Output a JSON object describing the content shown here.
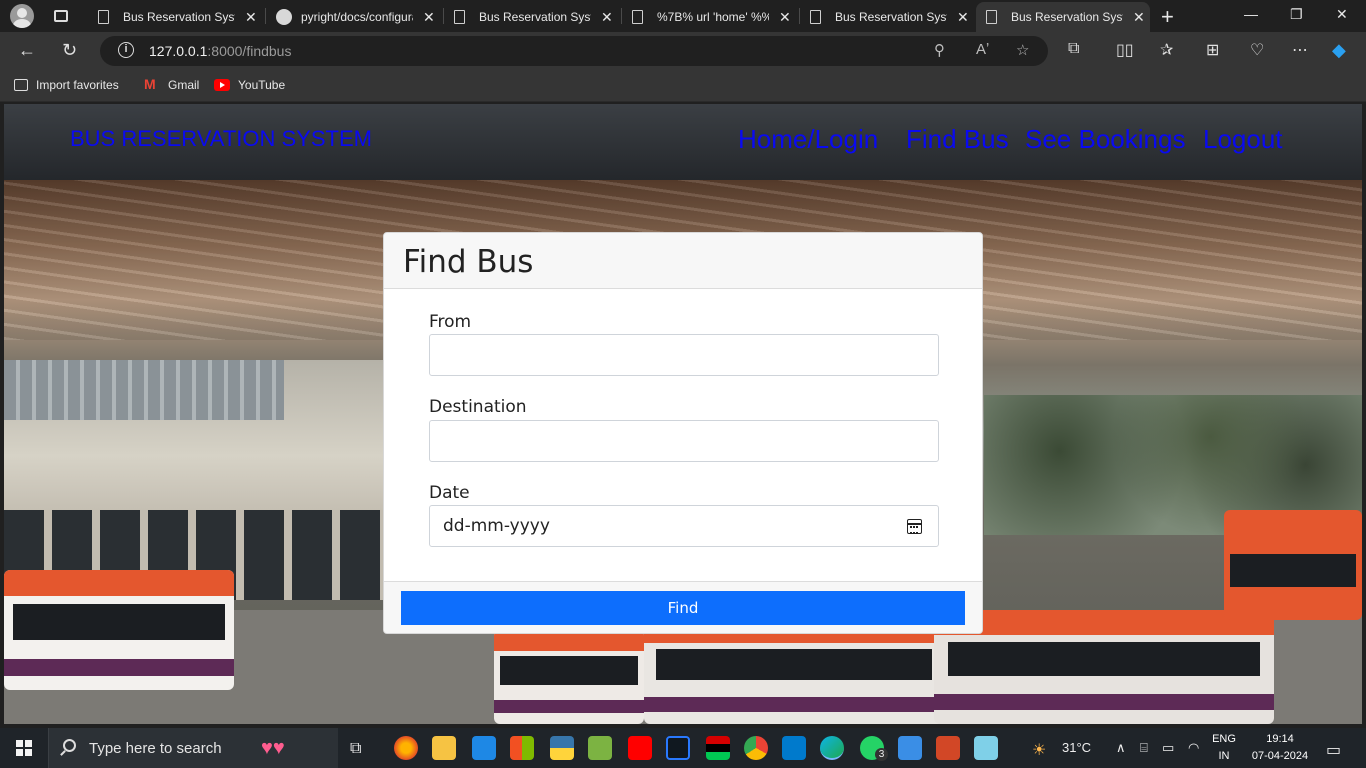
{
  "browser": {
    "tabs": [
      {
        "label": "Bus Reservation System",
        "icon": "page-icon"
      },
      {
        "label": "pyright/docs/configuration",
        "icon": "github-icon"
      },
      {
        "label": "Bus Reservation System",
        "icon": "page-icon"
      },
      {
        "label": "%7B% url 'home' %%7D",
        "icon": "page-icon"
      },
      {
        "label": "Bus Reservation System",
        "icon": "page-icon"
      },
      {
        "label": "Bus Reservation System",
        "icon": "page-icon",
        "active": true
      }
    ],
    "url_host": "127.0.0.1",
    "url_rest": ":8000/findbus",
    "favorites": [
      {
        "label": "Import favorites",
        "icon": "import-icon"
      },
      {
        "label": "Gmail",
        "icon": "gmail-icon"
      },
      {
        "label": "YouTube",
        "icon": "youtube-icon"
      }
    ]
  },
  "site": {
    "brand": "BUS RESERVATION SYSTEM",
    "nav": [
      "Home/Login",
      "Find Bus",
      "See Bookings",
      "Logout"
    ],
    "link_color": "#0a0af0"
  },
  "form": {
    "title": "Find Bus",
    "from_label": "From",
    "from_value": "",
    "destination_label": "Destination",
    "destination_value": "",
    "date_label": "Date",
    "date_placeholder": "dd-mm-yyyy",
    "submit_label": "Find",
    "button_color": "#0d6efd"
  },
  "taskbar": {
    "search_placeholder": "Type here to search",
    "weather": "31°C",
    "lang_line1": "ENG",
    "lang_line2": "IN",
    "time": "19:14",
    "date": "07-04-2024",
    "whatsapp_badge": "3"
  }
}
